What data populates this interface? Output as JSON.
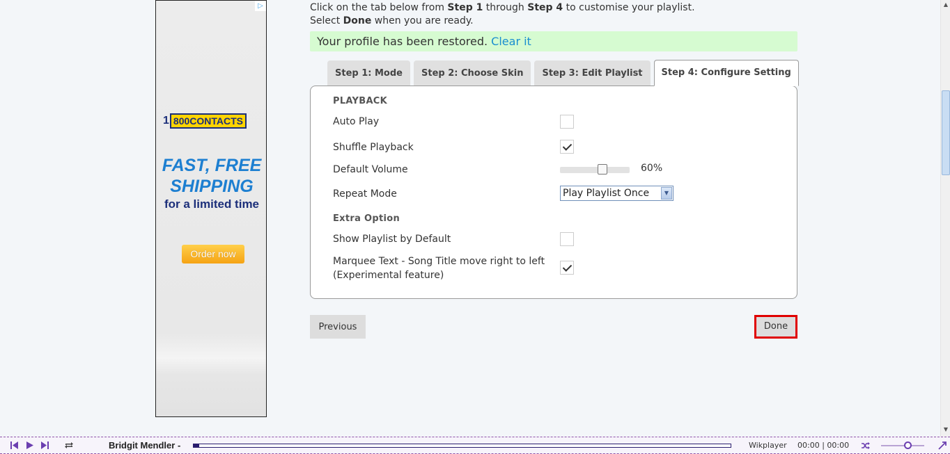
{
  "ad": {
    "badge": "▷",
    "logo_number": "1",
    "logo_text": "800CONTACTS",
    "headline_line1": "FAST, FREE",
    "headline_line2": "SHIPPING",
    "subline": "for a limited time",
    "button": "Order now"
  },
  "intro": {
    "line1_a": "Click on the tab below from ",
    "line1_b": "Step 1",
    "line1_c": " through ",
    "line1_d": "Step 4",
    "line1_e": " to customise your playlist.",
    "line2_a": "Select ",
    "line2_b": "Done",
    "line2_c": " when you are ready."
  },
  "notice": {
    "text": "Your profile has been restored. ",
    "link": "Clear it"
  },
  "tabs": [
    {
      "label": "Step 1: Mode"
    },
    {
      "label": "Step 2: Choose Skin"
    },
    {
      "label": "Step 3: Edit Playlist"
    },
    {
      "label": "Step 4: Configure Setting"
    }
  ],
  "settings": {
    "section_playback": "PLAYBACK",
    "auto_play": {
      "label": "Auto Play",
      "checked": false
    },
    "shuffle": {
      "label": "Shuffle Playback",
      "checked": true
    },
    "volume": {
      "label": "Default Volume",
      "value": 60,
      "display": "60%"
    },
    "repeat": {
      "label": "Repeat Mode",
      "selected": "Play Playlist Once"
    },
    "section_extra": "Extra Option",
    "show_playlist": {
      "label": "Show Playlist by Default",
      "checked": false
    },
    "marquee": {
      "label_line1": "Marquee Text - Song Title move right to left",
      "label_line2": "(Experimental feature)",
      "checked": true
    }
  },
  "buttons": {
    "previous": "Previous",
    "done": "Done"
  },
  "player": {
    "title": "Bridgit Mendler -",
    "brand": "Wikplayer",
    "time": "00:00 | 00:00",
    "progress": 0.01,
    "volume": 0.6
  },
  "colors": {
    "accent_purple": "#6b3fb0",
    "notice_bg": "#d6fbd1",
    "link": "#1a8ed0",
    "done_highlight": "#e00000"
  }
}
